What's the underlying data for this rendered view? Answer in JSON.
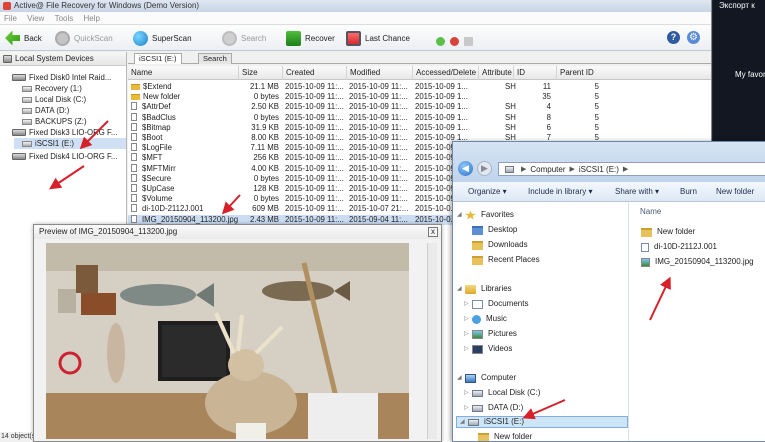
{
  "app": {
    "title": "Active@ File Recovery for Windows (Demo Version)",
    "menu": [
      "File",
      "View",
      "Tools",
      "Help"
    ],
    "toolbar": {
      "back": "Back",
      "quickscan": "QuickScan",
      "superscan": "SuperScan",
      "search": "Search",
      "recover": "Recover",
      "last_chance": "Last Chance"
    }
  },
  "tree": {
    "header": "Local System Devices",
    "items": [
      {
        "label": "Fixed Disk0 Intel   Raid..."
      },
      {
        "label": "Recovery (1:)"
      },
      {
        "label": "Local Disk (C:)"
      },
      {
        "label": "DATA (D:)"
      },
      {
        "label": "BACKUPS (Z:)"
      },
      {
        "label": "Fixed Disk3 LIO-ORG F..."
      },
      {
        "label": "iSCSI1 (E:)"
      },
      {
        "label": "Fixed Disk4 LIO-ORG F..."
      }
    ]
  },
  "tabs": [
    {
      "label": "iSCSI1 (E:)"
    },
    {
      "label": "Search"
    }
  ],
  "table": {
    "columns": [
      "Name",
      "Size",
      "Created",
      "Modified",
      "Accessed/Delete",
      "Attribute",
      "ID",
      "Parent ID"
    ],
    "rows": [
      {
        "name": "$Extend",
        "size": "21.1 MB",
        "created": "2015-10-09 11:...",
        "modified": "2015-10-09 11:...",
        "accessed": "2015-10-09 1...",
        "attr": "SH",
        "id": "11",
        "pid": "5",
        "type": "folder"
      },
      {
        "name": "New folder",
        "size": "0 bytes",
        "created": "2015-10-09 11:...",
        "modified": "2015-10-09 11:...",
        "accessed": "2015-10-09 1...",
        "attr": "",
        "id": "35",
        "pid": "5",
        "type": "folder"
      },
      {
        "name": "$AttrDef",
        "size": "2.50 KB",
        "created": "2015-10-09 11:...",
        "modified": "2015-10-09 11:...",
        "accessed": "2015-10-09 1...",
        "attr": "SH",
        "id": "4",
        "pid": "5",
        "type": "file"
      },
      {
        "name": "$BadClus",
        "size": "0 bytes",
        "created": "2015-10-09 11:...",
        "modified": "2015-10-09 11:...",
        "accessed": "2015-10-09 1...",
        "attr": "SH",
        "id": "8",
        "pid": "5",
        "type": "file"
      },
      {
        "name": "$Bitmap",
        "size": "31.9 KB",
        "created": "2015-10-09 11:...",
        "modified": "2015-10-09 11:...",
        "accessed": "2015-10-09 1...",
        "attr": "SH",
        "id": "6",
        "pid": "5",
        "type": "file"
      },
      {
        "name": "$Boot",
        "size": "8.00 KB",
        "created": "2015-10-09 11:...",
        "modified": "2015-10-09 11:...",
        "accessed": "2015-10-09 1...",
        "attr": "SH",
        "id": "7",
        "pid": "5",
        "type": "file"
      },
      {
        "name": "$LogFile",
        "size": "7.11 MB",
        "created": "2015-10-09 11:...",
        "modified": "2015-10-09 11:...",
        "accessed": "2015-10-09 1...",
        "attr": "",
        "id": "",
        "pid": "",
        "type": "file"
      },
      {
        "name": "$MFT",
        "size": "256 KB",
        "created": "2015-10-09 11:...",
        "modified": "2015-10-09 11:...",
        "accessed": "2015-10-09 1...",
        "attr": "",
        "id": "",
        "pid": "",
        "type": "file"
      },
      {
        "name": "$MFTMirr",
        "size": "4.00 KB",
        "created": "2015-10-09 11:...",
        "modified": "2015-10-09 11:...",
        "accessed": "2015-10-09 1...",
        "attr": "",
        "id": "",
        "pid": "",
        "type": "file"
      },
      {
        "name": "$Secure",
        "size": "0 bytes",
        "created": "2015-10-09 11:...",
        "modified": "2015-10-09 11:...",
        "accessed": "2015-10-09 1...",
        "attr": "",
        "id": "",
        "pid": "",
        "type": "file"
      },
      {
        "name": "$UpCase",
        "size": "128 KB",
        "created": "2015-10-09 11:...",
        "modified": "2015-10-09 11:...",
        "accessed": "2015-10-09 1...",
        "attr": "",
        "id": "",
        "pid": "",
        "type": "file"
      },
      {
        "name": "$Volume",
        "size": "0 bytes",
        "created": "2015-10-09 11:...",
        "modified": "2015-10-09 11:...",
        "accessed": "2015-10-09 1...",
        "attr": "",
        "id": "",
        "pid": "",
        "type": "file"
      },
      {
        "name": "di-10D-2112J.001",
        "size": "609 MB",
        "created": "2015-10-09 11:...",
        "modified": "2015-10-07 21:...",
        "accessed": "2015-10-0...",
        "attr": "",
        "id": "",
        "pid": "",
        "type": "file"
      },
      {
        "name": "IMG_20150904_113200.jpg",
        "size": "2.43 MB",
        "created": "2015-10-09 11:...",
        "modified": "2015-09-04 11:...",
        "accessed": "2015-10-0...",
        "attr": "",
        "id": "",
        "pid": "",
        "type": "file"
      }
    ]
  },
  "preview": {
    "title": "Preview of IMG_20150904_113200.jpg",
    "close": "x"
  },
  "status": "14 object(s)",
  "explorer": {
    "address": [
      "Computer",
      "iSCSI1 (E:)"
    ],
    "commands": [
      "Organize ▾",
      "Include in library ▾",
      "Share with ▾",
      "Burn",
      "New folder"
    ],
    "nav": {
      "favorites": "Favorites",
      "desktop": "Desktop",
      "downloads": "Downloads",
      "recent": "Recent Places",
      "libraries": "Libraries",
      "documents": "Documents",
      "music": "Music",
      "pictures": "Pictures",
      "videos": "Videos",
      "computer": "Computer",
      "local_disk": "Local Disk (C:)",
      "data": "DATA (D:)",
      "iscsi": "iSCSI1 (E:)",
      "new_folder": "New folder"
    },
    "content_header": "Name",
    "content": [
      {
        "name": "New folder",
        "type": "folder"
      },
      {
        "name": "di-10D-2112J.001",
        "type": "file"
      },
      {
        "name": "IMG_20150904_113200.jpg",
        "type": "image"
      }
    ]
  },
  "background": {
    "export_label": "Экспорт к",
    "favorites_label": "My favorit"
  },
  "colors": {
    "arrow_red": "#d6202a",
    "selection": "#cbdcf3"
  }
}
